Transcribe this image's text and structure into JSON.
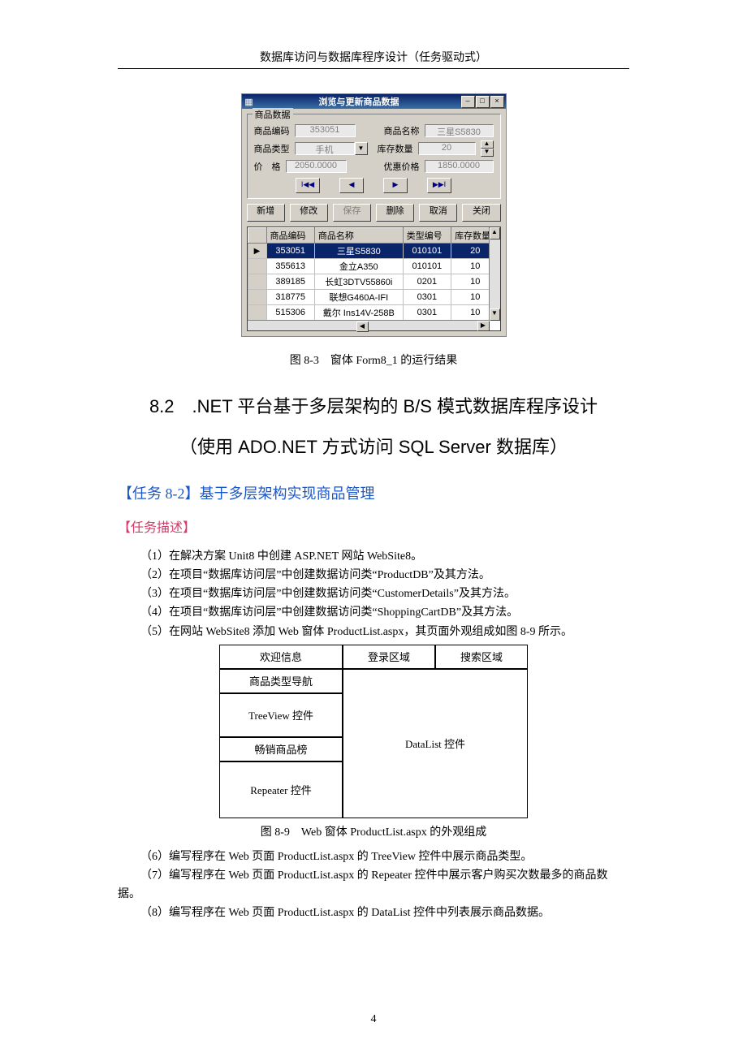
{
  "runningHeader": "数据库访问与数据库程序设计（任务驱动式）",
  "pageNumber": "4",
  "winform": {
    "title": "浏览与更新商品数据",
    "sysButtons": {
      "min": "–",
      "max": "□",
      "close": "×"
    },
    "groupTitle": "商品数据",
    "labels": {
      "productCode": "商品编码",
      "productName": "商品名称",
      "productType": "商品类型",
      "stockQty": "库存数量",
      "price": "价　格",
      "promoPrice": "优惠价格"
    },
    "values": {
      "productCode": "353051",
      "productName": "三星S5830",
      "productType": "手机",
      "stockQty": "20",
      "price": "2050.0000",
      "promoPrice": "1850.0000"
    },
    "nav": {
      "first": "I◀◀",
      "prev": "◀",
      "next": "▶",
      "last": "▶▶I"
    },
    "actionButtons": {
      "add": "新增",
      "edit": "修改",
      "save": "保存",
      "delete": "删除",
      "cancel": "取消",
      "close": "关闭"
    },
    "gridHeaders": {
      "code": "商品编码",
      "name": "商品名称",
      "typeId": "类型编号",
      "qty": "库存数量"
    },
    "gridRows": [
      {
        "code": "353051",
        "name": "三星S5830",
        "typeId": "010101",
        "qty": "20",
        "selected": true
      },
      {
        "code": "355613",
        "name": "金立A350",
        "typeId": "010101",
        "qty": "10"
      },
      {
        "code": "389185",
        "name": "长虹3DTV55860i",
        "typeId": "0201",
        "qty": "10"
      },
      {
        "code": "318775",
        "name": "联想G460A-IFI",
        "typeId": "0301",
        "qty": "10"
      },
      {
        "code": "515306",
        "name": "戴尔 Ins14V-258B",
        "typeId": "0301",
        "qty": "10"
      }
    ]
  },
  "captions": {
    "fig83": "图 8-3　窗体 Form8_1 的运行结果",
    "fig89": "图 8-9　Web 窗体 ProductList.aspx 的外观组成"
  },
  "headings": {
    "sectionLine1": "8.2　.NET 平台基于多层架构的 B/S 模式数据库程序设计",
    "sectionLine2": "（使用 ADO.NET 方式访问 SQL Server 数据库）",
    "task": "【任务 8-2】基于多层架构实现商品管理",
    "desc": "【任务描述】"
  },
  "paragraphs": {
    "p1": "（1）在解决方案 Unit8 中创建 ASP.NET 网站 WebSite8。",
    "p2": "（2）在项目“数据库访问层”中创建数据访问类“ProductDB”及其方法。",
    "p3": "（3）在项目“数据库访问层”中创建数据访问类“CustomerDetails”及其方法。",
    "p4": "（4）在项目“数据库访问层”中创建数据访问类“ShoppingCartDB”及其方法。",
    "p5": "（5）在网站 WebSite8 添加 Web 窗体 ProductList.aspx，其页面外观组成如图 8-9 所示。",
    "p6": "（6）编写程序在 Web 页面 ProductList.aspx 的 TreeView 控件中展示商品类型。",
    "p7": "（7）编写程序在 Web 页面 ProductList.aspx 的 Repeater 控件中展示客户购买次数最多的商品数据。",
    "p8": "（8）编写程序在 Web 页面 ProductList.aspx 的 DataList 控件中列表展示商品数据。"
  },
  "layoutDiagram": {
    "welcome": "欢迎信息",
    "login": "登录区域",
    "search": "搜索区域",
    "nav": "商品类型导航",
    "tree": "TreeView 控件",
    "hot": "畅销商品榜",
    "rep": "Repeater 控件",
    "datalist": "DataList 控件"
  }
}
